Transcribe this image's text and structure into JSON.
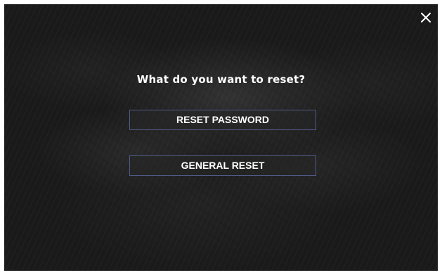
{
  "dialog": {
    "title": "What do you want to reset?",
    "close_icon": "close-icon"
  },
  "buttons": {
    "reset_password": "RESET PASSWORD",
    "general_reset": "GENERAL RESET"
  },
  "colors": {
    "background": "#1a1a1a",
    "text": "#ffffff",
    "button_border": "#4f5a86"
  }
}
